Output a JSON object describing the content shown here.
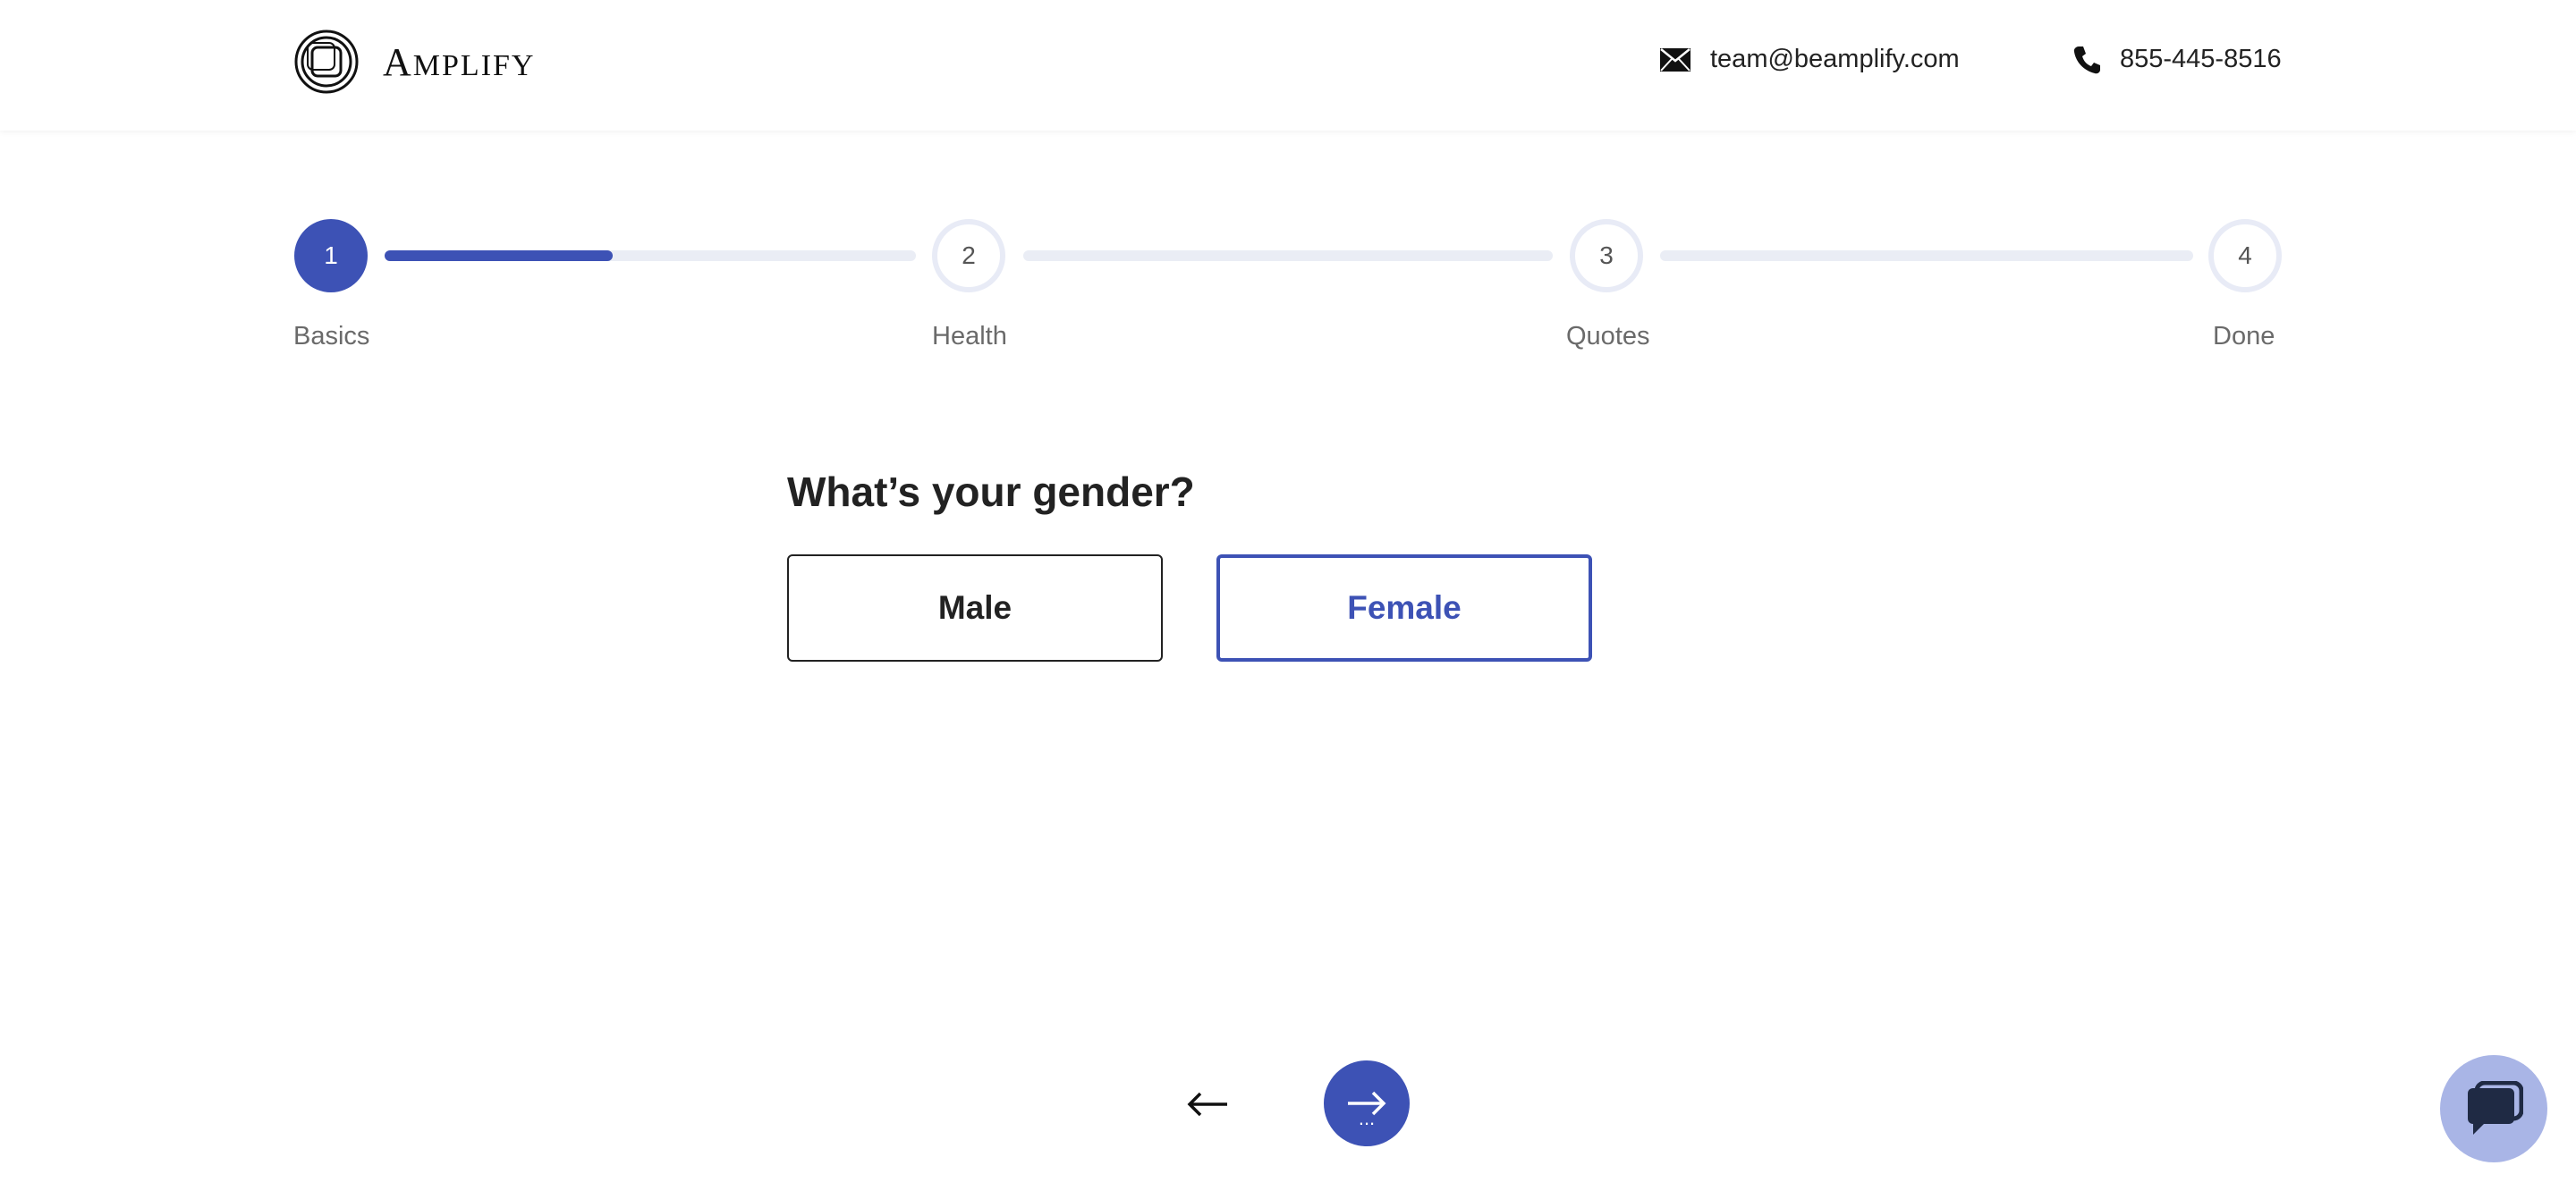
{
  "header": {
    "logo_text_first": "A",
    "logo_text_rest": "MPLIFY",
    "email": "team@beamplify.com",
    "phone": "855-445-8516"
  },
  "stepper": {
    "steps": [
      {
        "number": "1",
        "label": "Basics",
        "state": "active"
      },
      {
        "number": "2",
        "label": "Health",
        "state": "inactive"
      },
      {
        "number": "3",
        "label": "Quotes",
        "state": "inactive"
      },
      {
        "number": "4",
        "label": "Done",
        "state": "inactive"
      }
    ],
    "progress_segment_1": 0.43
  },
  "question": {
    "title": "What’s your gender?",
    "options": [
      {
        "label": "Male",
        "selected": false
      },
      {
        "label": "Female",
        "selected": true
      }
    ]
  },
  "nav": {
    "back_icon": "arrow-left-icon",
    "next_icon": "arrow-right-icon",
    "next_dots": "..."
  },
  "chat": {
    "icon": "chat-bubbles-icon"
  },
  "colors": {
    "accent": "#3d52b5",
    "track": "#eaedf5",
    "chat_bg": "#a9b5e6"
  }
}
